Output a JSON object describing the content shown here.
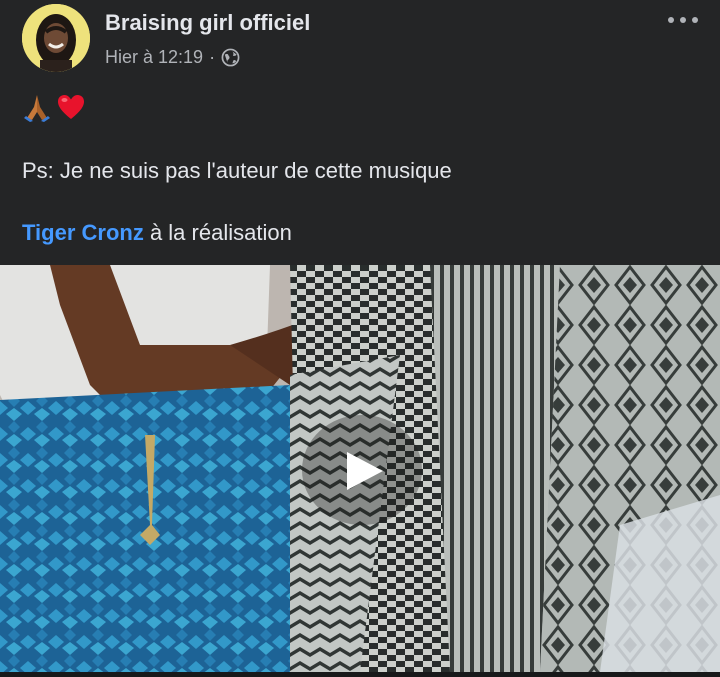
{
  "post": {
    "author": "Braising girl officiel",
    "timestamp": "Hier à 12:19",
    "separator": "·",
    "privacy_icon": "globe-icon",
    "more_icon": "more-options-icon",
    "emojis": [
      "folded-hands-emoji",
      "red-heart-emoji"
    ],
    "text_line1": "Ps: Je ne suis pas l'auteur de cette musique",
    "text_line2_link": "Tiger Cronz",
    "text_line2_rest": " à la réalisation"
  },
  "video": {
    "play_icon": "play-icon"
  },
  "colors": {
    "background": "#242526",
    "text": "#e4e6eb",
    "secondary_text": "#b0b3b8",
    "link": "#4599ff"
  }
}
